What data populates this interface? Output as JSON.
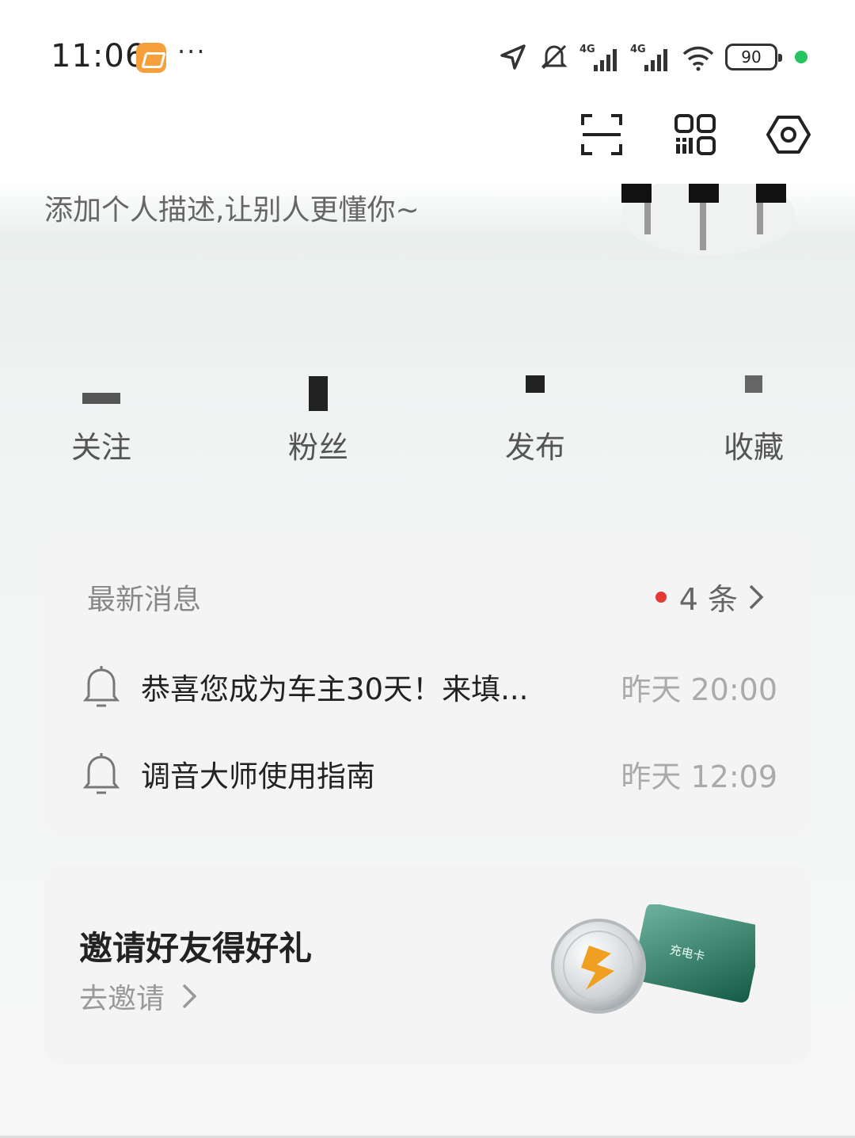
{
  "status_bar": {
    "time": "11:06",
    "more_dots": "···",
    "battery": "90",
    "icons": [
      "location-icon",
      "mute-bell-icon",
      "signal-4g-icon",
      "signal-4g-icon",
      "wifi-icon",
      "battery-icon",
      "green-dot"
    ]
  },
  "header": {
    "icons": [
      "scan-icon",
      "qrcode-icon",
      "settings-icon"
    ]
  },
  "profile": {
    "description": "添加个人描述,让别人更懂你~"
  },
  "stats": [
    {
      "label": "关注"
    },
    {
      "label": "粉丝"
    },
    {
      "label": "发布"
    },
    {
      "label": "收藏"
    }
  ],
  "messages": {
    "title": "最新消息",
    "count": "4 条",
    "items": [
      {
        "text": "恭喜您成为车主30天！来填...",
        "time": "昨天 20:00"
      },
      {
        "text": "调音大师使用指南",
        "time": "昨天 12:09"
      }
    ]
  },
  "invite": {
    "title": "邀请好友得好礼",
    "link": "去邀请",
    "card_text": "充电卡"
  },
  "colors": {
    "accent_green": "#1f8a6a",
    "red_dot": "#e53935",
    "status_green": "#22c55e"
  }
}
